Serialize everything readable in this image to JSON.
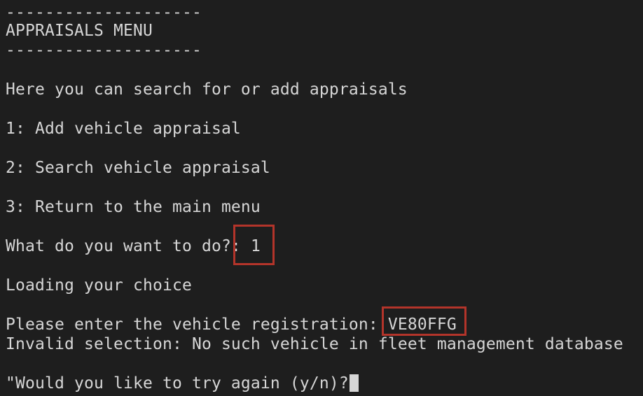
{
  "menu": {
    "divider_top": "--------------------",
    "title": "APPRAISALS MENU",
    "divider_bottom": "--------------------",
    "intro": "Here you can search for or add appraisals",
    "options": [
      "1: Add vehicle appraisal",
      "2: Search vehicle appraisal",
      "3: Return to the main menu"
    ]
  },
  "prompt": {
    "question": "What do you want to do?: ",
    "answer": "1"
  },
  "loading": "Loading your choice",
  "registration": {
    "question": "Please enter the vehicle registration: ",
    "answer": "VE80FFG"
  },
  "error": "Invalid selection: No such vehicle in fleet management database",
  "retry_prompt": "\"Would you like to try again (y/n)?"
}
